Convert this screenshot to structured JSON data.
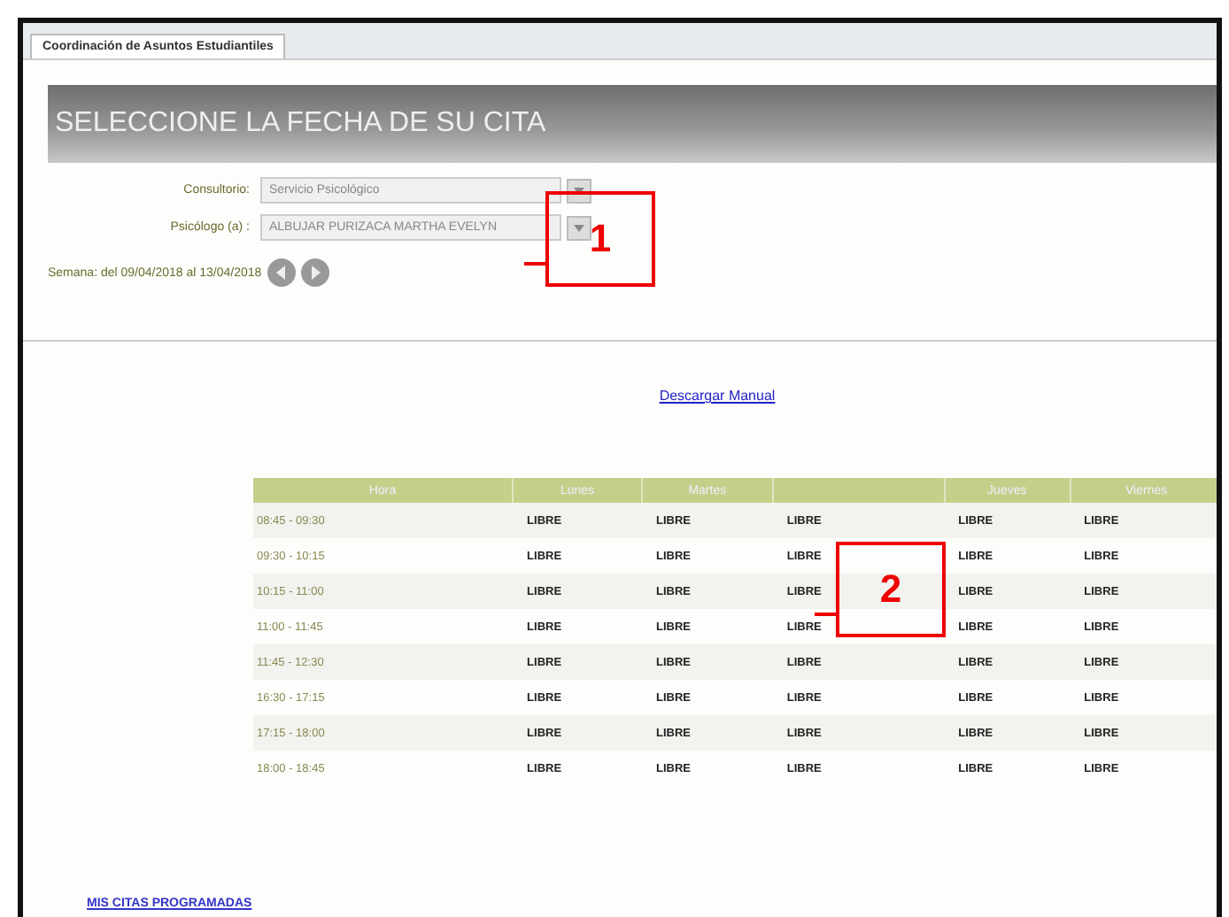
{
  "tab": {
    "label": "Coordinación de Asuntos Estudiantiles",
    "selected": true
  },
  "title": "SELECCIONE LA FECHA DE SU CITA",
  "form": [
    {
      "label": "Consultorio:",
      "value": "Servicio Psicológico"
    },
    {
      "label": "Psicólogo (a) :",
      "value": "ALBUJAR PURIZACA MARTHA EVELYN"
    }
  ],
  "week": "Semana: del 09/04/2018 al 13/04/2018",
  "manual_link": "Descargar Manual",
  "table": {
    "columns": [
      "Hora",
      "Lunes",
      "Martes",
      "",
      "Jueves",
      "Viernes"
    ],
    "rows": [
      [
        "08:45 - 09:30",
        "LIBRE",
        "LIBRE",
        "LIBRE",
        "LIBRE",
        "LIBRE"
      ],
      [
        "09:30 - 10:15",
        "LIBRE",
        "LIBRE",
        "LIBRE",
        "LIBRE",
        "LIBRE"
      ],
      [
        "10:15 - 11:00",
        "LIBRE",
        "LIBRE",
        "LIBRE",
        "LIBRE",
        "LIBRE"
      ],
      [
        "11:00 - 11:45",
        "LIBRE",
        "LIBRE",
        "LIBRE",
        "LIBRE",
        "LIBRE"
      ],
      [
        "11:45 - 12:30",
        "LIBRE",
        "LIBRE",
        "LIBRE",
        "LIBRE",
        "LIBRE"
      ],
      [
        "16:30 - 17:15",
        "LIBRE",
        "LIBRE",
        "LIBRE",
        "LIBRE",
        "LIBRE"
      ],
      [
        "17:15 - 18:00",
        "LIBRE",
        "LIBRE",
        "LIBRE",
        "LIBRE",
        "LIBRE"
      ],
      [
        "18:00 - 18:45",
        "LIBRE",
        "LIBRE",
        "LIBRE",
        "LIBRE",
        "LIBRE"
      ]
    ]
  },
  "bottom_link": "MIS CITAS PROGRAMADAS",
  "annotations": [
    {
      "label": "1"
    },
    {
      "label": "2"
    }
  ]
}
